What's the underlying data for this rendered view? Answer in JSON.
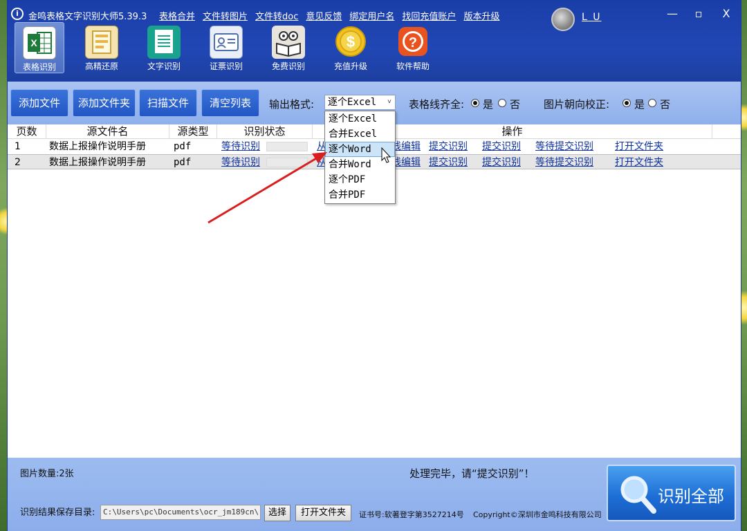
{
  "app": {
    "title": "金鸣表格文字识别大师5.39.3",
    "logo_glyph": "i",
    "menu_links": [
      "表格合并",
      "文件转图片",
      "文件转doc",
      "意见反馈",
      "绑定用户名",
      "找回充值账户",
      "版本升级"
    ],
    "user_name": "L U",
    "window_controls": {
      "minimize": "—",
      "maximize": "▫",
      "close": "X"
    }
  },
  "toolbar": {
    "items": [
      {
        "label": "表格识别",
        "icon": "excel-icon",
        "active": true
      },
      {
        "label": "高精还原",
        "icon": "document-restore-icon",
        "active": false
      },
      {
        "label": "文字识别",
        "icon": "text-document-icon",
        "active": false
      },
      {
        "label": "证票识别",
        "icon": "id-card-icon",
        "active": false
      },
      {
        "label": "免费识别",
        "icon": "owl-book-icon",
        "active": false
      },
      {
        "label": "充值升级",
        "icon": "dollar-coin-icon",
        "active": false
      },
      {
        "label": "软件帮助",
        "icon": "help-icon",
        "active": false
      }
    ]
  },
  "actions": {
    "add_file": "添加文件",
    "add_folder": "添加文件夹",
    "scan_file": "扫描文件",
    "clear_list": "清空列表",
    "output_format_label": "输出格式:",
    "output_format_value": "逐个Excel",
    "grid_label": "表格线齐全:",
    "grid_yes": "是",
    "grid_no": "否",
    "grid_selected": "yes",
    "orient_label": "图片朝向校正:",
    "orient_yes": "是",
    "orient_no": "否",
    "orient_selected": "yes"
  },
  "dropdown": {
    "options": [
      "逐个Excel",
      "合并Excel",
      "逐个Word",
      "合并Word",
      "逐个PDF",
      "合并PDF"
    ],
    "hovered_index": 2
  },
  "table": {
    "headers": [
      "页数",
      "源文件名",
      "源类型",
      "识别状态",
      "操作"
    ],
    "rows": [
      {
        "page": "1",
        "name": "数据上报操作说明手册",
        "type": "pdf",
        "status": "等待识别",
        "partial": "从",
        "ops": [
          "在线编辑",
          "提交识别",
          "提交识别",
          "等待提交识别",
          "打开文件夹"
        ]
      },
      {
        "page": "2",
        "name": "数据上报操作说明手册",
        "type": "pdf",
        "status": "等待识别",
        "partial": "从",
        "ops": [
          "在线编辑",
          "提交识别",
          "提交识别",
          "等待提交识别",
          "打开文件夹"
        ]
      }
    ]
  },
  "bottom": {
    "image_count": "图片数量:2张",
    "status_message": "处理完毕，请“提交识别”！",
    "save_dir_label": "识别结果保存目录:",
    "save_dir_value": "C:\\Users\\pc\\Documents\\ocr_jm189cn\\",
    "choose_btn": "选择",
    "open_folder_btn": "打开文件夹",
    "cert_text": "证书号:软著登字第3527214号",
    "copyright": "Copyright©深圳市金鸣科技有限公司",
    "recognize_all": "识别全部"
  },
  "colors": {
    "title_bar": "#1a3ea8",
    "action_bar": "#9cbcf0",
    "button_blue": "#2156c4",
    "link": "#0b2f9e",
    "arrow_red": "#d81e1e"
  }
}
